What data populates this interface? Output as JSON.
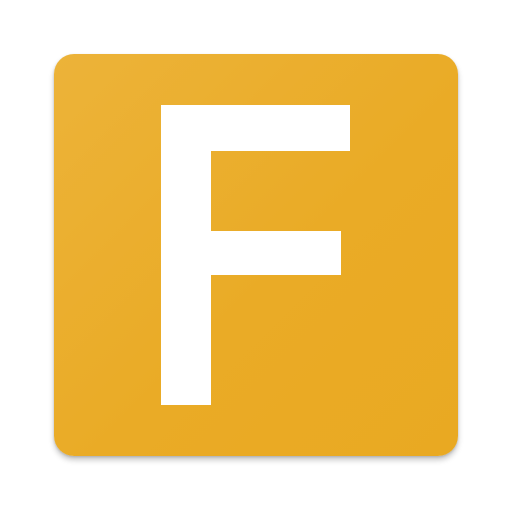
{
  "icon": {
    "letter": "F",
    "background_color": "#eaad2a",
    "letter_color": "#ffffff"
  }
}
